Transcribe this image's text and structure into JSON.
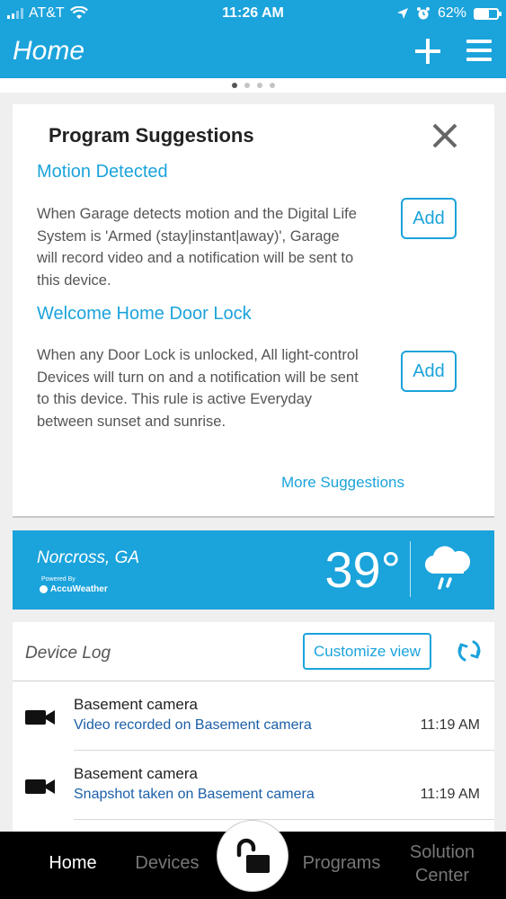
{
  "status_bar": {
    "carrier": "AT&T",
    "time": "11:26 AM",
    "battery_percent": "62%",
    "battery_level": 0.62
  },
  "header": {
    "title": "Home",
    "page_dots": 4,
    "active_dot": 0
  },
  "suggestions": {
    "title": "Program Suggestions",
    "items": [
      {
        "title": "Motion Detected",
        "description": "When Garage detects motion and the Digital Life System is 'Armed (stay|instant|away)', Garage will record video and a notification will be sent to this device.",
        "button_label": "Add"
      },
      {
        "title": "Welcome Home Door Lock",
        "description": "When any Door Lock is unlocked, All light-control Devices will turn on and a notification will be sent to this device. This rule is active Everyday between sunset and sunrise.",
        "button_label": "Add"
      }
    ],
    "more_label": "More Suggestions"
  },
  "weather": {
    "city": "Norcross, GA",
    "powered_by": "Powered By",
    "provider": "AccuWeather",
    "temperature": "39°",
    "condition_icon": "rain-cloud-icon"
  },
  "device_log": {
    "title": "Device Log",
    "customize_label": "Customize view",
    "entries": [
      {
        "device": "Basement camera",
        "event": "Video recorded on Basement camera",
        "time": "11:19 AM"
      },
      {
        "device": "Basement camera",
        "event": "Snapshot taken on Basement camera",
        "time": "11:19 AM"
      }
    ]
  },
  "tab_bar": {
    "tabs": [
      {
        "label": "Home",
        "active": true
      },
      {
        "label": "Devices",
        "active": false
      },
      {
        "label": "Programs",
        "active": false
      },
      {
        "label": "Solution Center",
        "active": false
      }
    ],
    "center_icon": "unlocked-padlock-icon"
  },
  "colors": {
    "accent": "#1ba3db",
    "link_dark": "#1b5fa8",
    "tab_bar": "#000000"
  }
}
